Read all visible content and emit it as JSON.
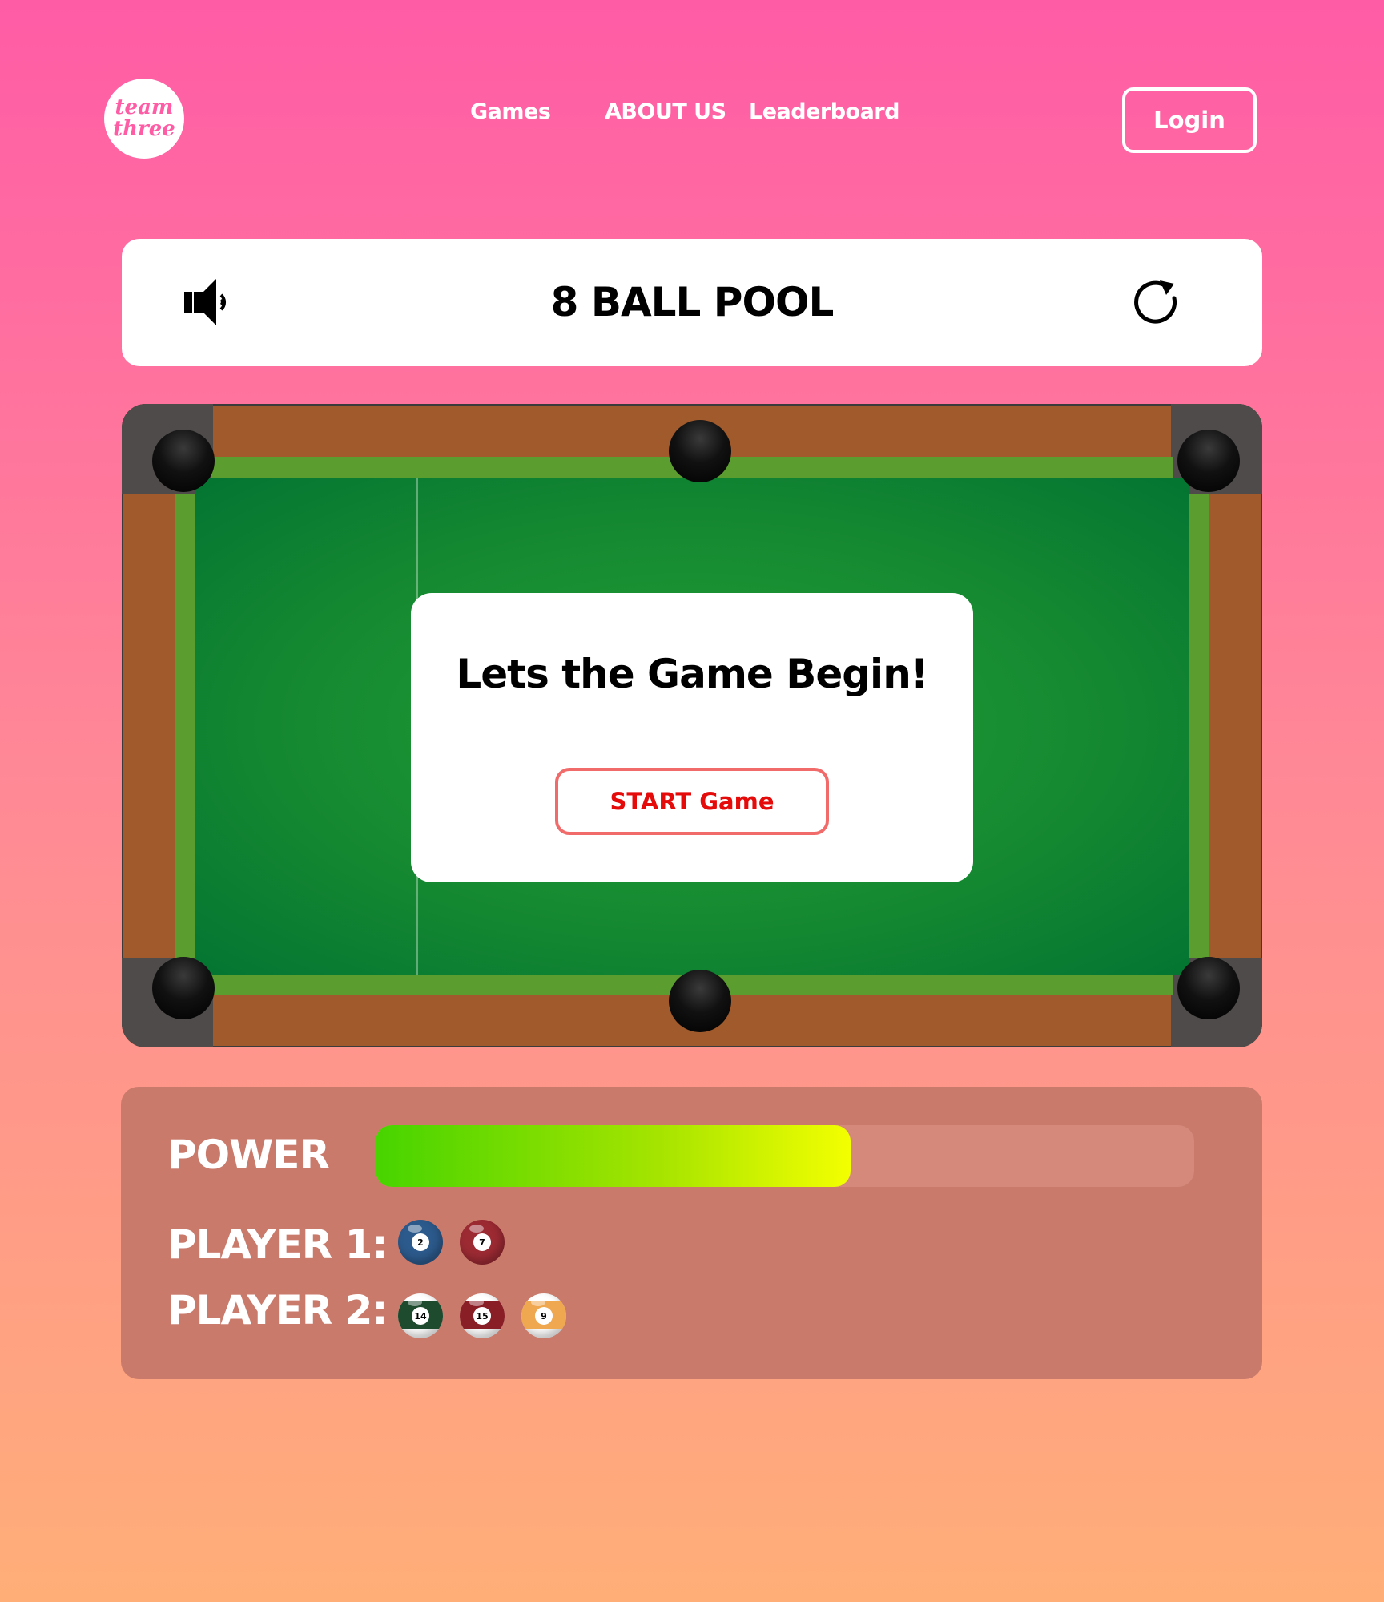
{
  "logo": {
    "line1": "team",
    "line2": "three"
  },
  "nav": {
    "games": "Games",
    "about": "ABOUT US",
    "leaderboard": "Leaderboard",
    "login": "Login"
  },
  "game": {
    "title": "8 BALL POOL",
    "overlay_message": "Lets the Game Begin!",
    "start_button": "START Game"
  },
  "panel": {
    "power_label": "POWER",
    "power_level": 0.58,
    "player1_label": "PLAYER 1:",
    "player2_label": "PLAYER 2:",
    "player1_balls": [
      {
        "number": "2",
        "color": "#2c5a8c",
        "striped": false
      },
      {
        "number": "7",
        "color": "#9c2a33",
        "striped": false
      }
    ],
    "player2_balls": [
      {
        "number": "14",
        "color": "#1e4a2e",
        "striped": true
      },
      {
        "number": "15",
        "color": "#8a1e26",
        "striped": true
      },
      {
        "number": "9",
        "color": "#f0a850",
        "striped": true
      }
    ]
  },
  "colors": {
    "accent": "#ff5ca6",
    "felt": "#168a31",
    "rail": "#a05a2c",
    "start_text": "#e50b0b"
  }
}
